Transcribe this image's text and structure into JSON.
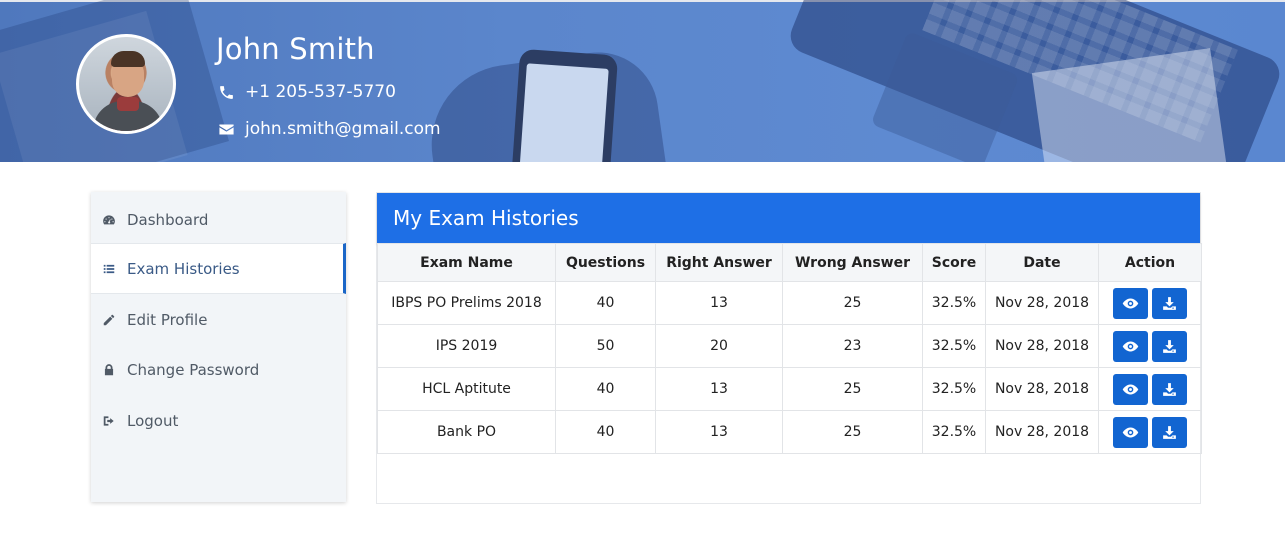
{
  "profile": {
    "name": "John Smith",
    "phone": "+1 205-537-5770",
    "email": "john.smith@gmail.com"
  },
  "sidebar": {
    "items": [
      {
        "label": "Dashboard",
        "icon": "dashboard-icon"
      },
      {
        "label": "Exam Histories",
        "icon": "list-icon",
        "active": true
      },
      {
        "label": "Edit Profile",
        "icon": "pencil-icon"
      },
      {
        "label": "Change Password",
        "icon": "lock-icon"
      },
      {
        "label": "Logout",
        "icon": "sign-out-icon"
      }
    ]
  },
  "main": {
    "title": "My Exam Histories",
    "columns": [
      "Exam Name",
      "Questions",
      "Right Answer",
      "Wrong Answer",
      "Score",
      "Date",
      "Action"
    ],
    "rows": [
      {
        "exam": "IBPS PO Prelims 2018",
        "questions": "40",
        "right": "13",
        "wrong": "25",
        "score": "32.5%",
        "date": "Nov 28, 2018"
      },
      {
        "exam": "IPS 2019",
        "questions": "50",
        "right": "20",
        "wrong": "23",
        "score": "32.5%",
        "date": "Nov 28, 2018"
      },
      {
        "exam": "HCL Aptitute",
        "questions": "40",
        "right": "13",
        "wrong": "25",
        "score": "32.5%",
        "date": "Nov 28, 2018"
      },
      {
        "exam": "Bank PO",
        "questions": "40",
        "right": "13",
        "wrong": "25",
        "score": "32.5%",
        "date": "Nov 28, 2018"
      }
    ],
    "action_icons": [
      "eye-icon",
      "download-icon"
    ]
  },
  "colors": {
    "accent": "#1e6fe6",
    "button": "#1265d1",
    "banner": "#5b86cc",
    "sidebar_bg": "#f2f5f8"
  }
}
